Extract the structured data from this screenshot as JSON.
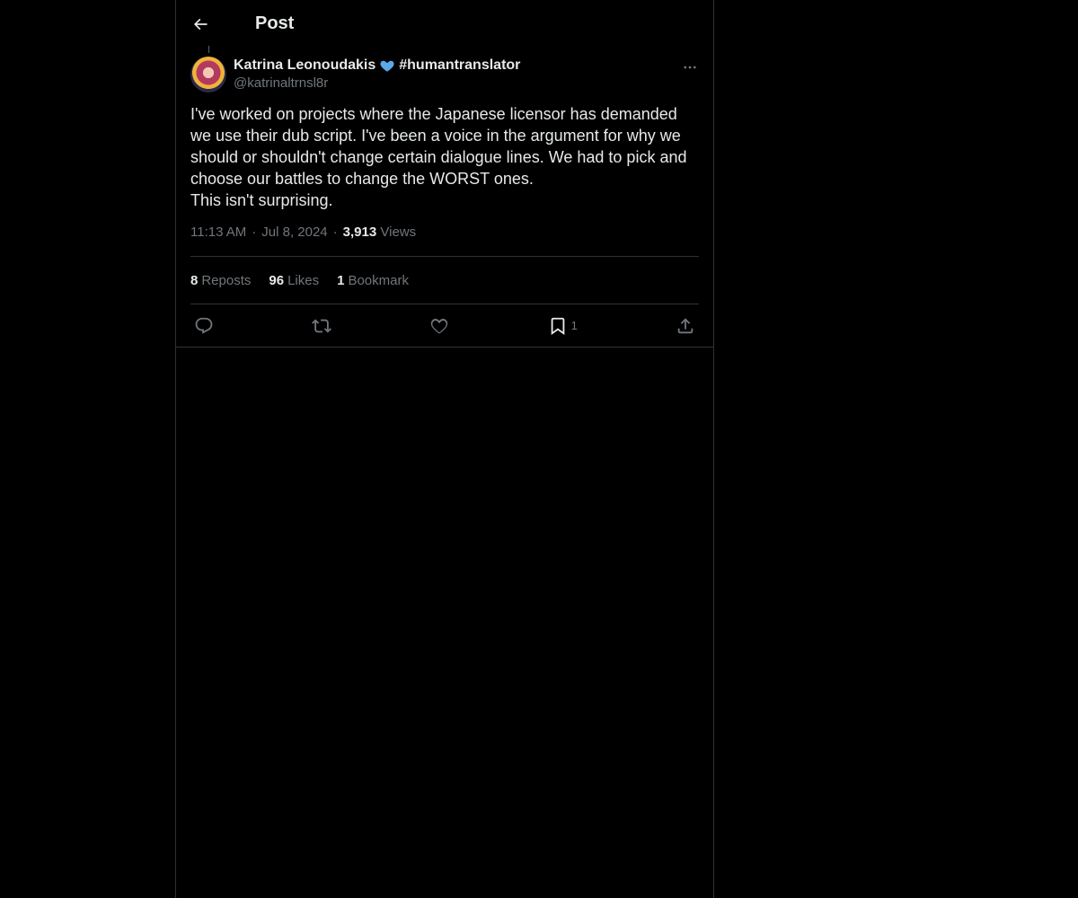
{
  "header": {
    "title": "Post"
  },
  "post": {
    "author_name": "Katrina Leonoudakis",
    "author_hashtag": "#humantranslator",
    "author_handle": "@katrinaltrnsl8r",
    "text": "I've worked on projects where the Japanese licensor has demanded we use their dub script. I've been a voice in the argument for why we should or shouldn't change certain dialogue lines. We had to pick and choose our battles to change the WORST ones.\nThis isn't surprising.",
    "time": "11:13 AM",
    "date": "Jul 8, 2024",
    "views_count": "3,913",
    "views_label": "Views",
    "dot": "·"
  },
  "stats": {
    "reposts_count": "8",
    "reposts_label": "Reposts",
    "likes_count": "96",
    "likes_label": "Likes",
    "bookmarks_count": "1",
    "bookmarks_label": "Bookmark"
  },
  "actions": {
    "bookmark_count": "1"
  },
  "icons": {
    "back": "arrow-left-icon",
    "verified_heart": "blue-heart-icon",
    "more": "ellipsis-icon",
    "reply": "reply-icon",
    "repost": "repost-icon",
    "like": "heart-icon",
    "bookmark": "bookmark-icon",
    "share": "share-icon"
  },
  "colors": {
    "background": "#000000",
    "text": "#e7e9ea",
    "muted": "#71767b",
    "border": "#2f3336",
    "heart_blue": "#5da8e8"
  }
}
